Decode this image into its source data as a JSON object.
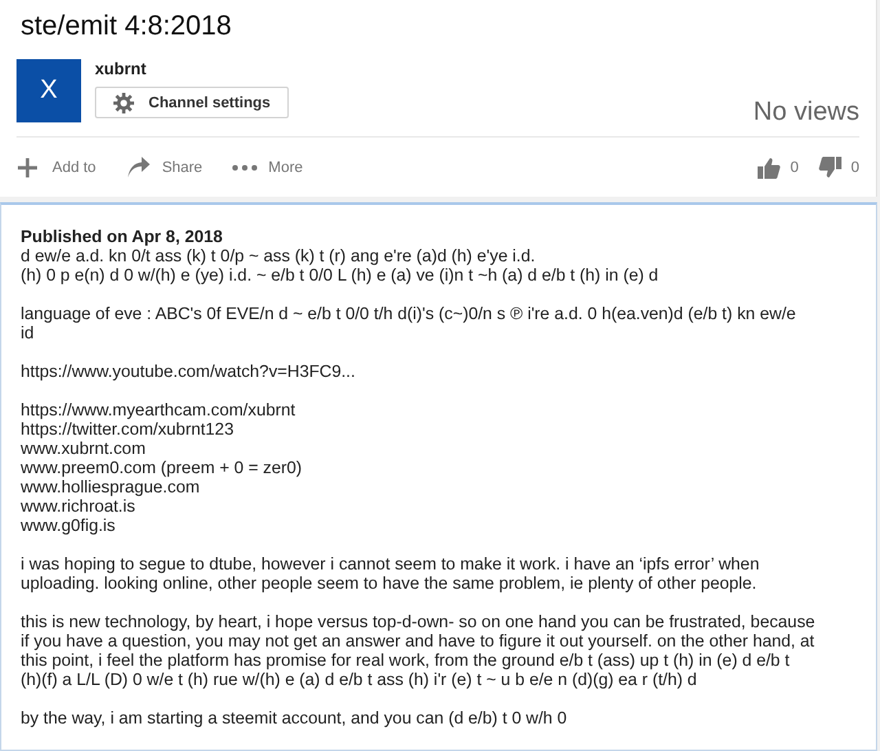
{
  "video": {
    "title": "ste/emit 4:8:2018",
    "views": "No views"
  },
  "channel": {
    "avatar_letter": "X",
    "name": "xubrnt",
    "settings_button": "Channel settings"
  },
  "actions": [
    {
      "kind": "add",
      "label": "Add to"
    },
    {
      "kind": "share",
      "label": "Share"
    },
    {
      "kind": "more",
      "label": "More"
    }
  ],
  "ratings": [
    {
      "kind": "like",
      "count": "0"
    },
    {
      "kind": "dislike",
      "count": "0"
    }
  ],
  "description": {
    "published": "Published on Apr 8, 2018",
    "paragraphs": [
      [
        "d ew/e a.d. kn 0/t ass (k) t 0/p ~ ass (k) t (r) ang e're (a)d (h) e'ye i.d.",
        "(h) 0 p e(n) d 0 w/(h) e (ye) i.d. ~ e/b t 0/0 L (h) e (a) ve (i)n t ~h (a) d e/b t (h) in (e) d"
      ],
      [
        "language of eve : ABC's 0f EVE/n d ~ e/b t 0/0 t/h d(i)'s (c~)0/n s ℗ i're a.d. 0 h(ea.ven)d (e/b t) kn ew/e",
        "id"
      ],
      [
        "https://www.youtube.com/watch?v=H3FC9..."
      ],
      [
        "https://www.myearthcam.com/xubrnt",
        "https://twitter.com/xubrnt123",
        "www.xubrnt.com",
        "www.preem0.com (preem + 0 = zer0)",
        "www.holliesprague.com",
        "www.richroat.is",
        "www.g0fig.is"
      ],
      [
        "i was hoping to segue to dtube, however i cannot seem to make it work. i have an ‘ipfs error’ when",
        "uploading. looking online, other people seem to have the same problem, ie plenty of other people."
      ],
      [
        "this is new technology, by heart, i hope versus top-d-own- so on one hand you can be frustrated, because",
        "if you have a question, you may not get an answer and have to figure it out yourself. on the other hand, at",
        "this point, i feel the platform has promise for real work, from the ground e/b t (ass) up t (h) in (e) d e/b t",
        "(h)(f) a L/L (D) 0 w/e t (h) rue w/(h) e (a) d e/b t ass (h) i'r (e) t ~ u b e/e n (d)(g) ea r (t/h) d"
      ],
      [
        "by the way, i am starting a steemit account, and you can (d e/b) t 0 w/h 0"
      ]
    ]
  }
}
